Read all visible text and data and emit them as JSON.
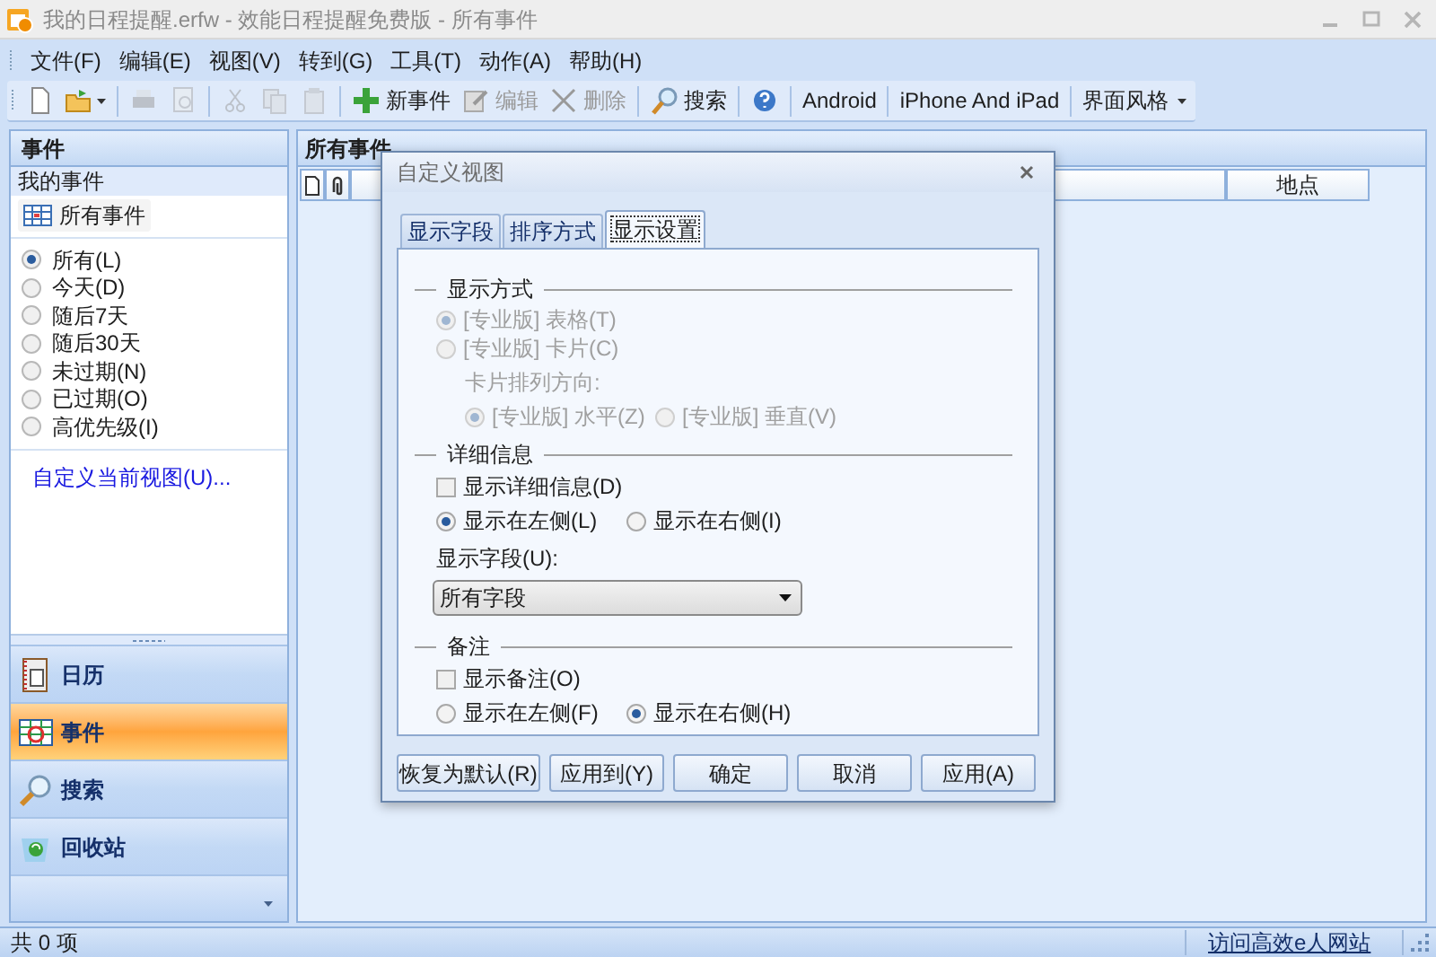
{
  "window": {
    "title": "我的日程提醒.erfw - 效能日程提醒免费版 - 所有事件"
  },
  "menu": [
    "文件(F)",
    "编辑(E)",
    "视图(V)",
    "转到(G)",
    "工具(T)",
    "动作(A)",
    "帮助(H)"
  ],
  "toolbar": [
    {
      "kind": "icon",
      "disabled": false
    },
    {
      "kind": "dropdown-icon",
      "disabled": false
    },
    {
      "kind": "separator"
    },
    {
      "kind": "icon",
      "disabled": true
    },
    {
      "kind": "icon",
      "disabled": true
    },
    {
      "kind": "separator"
    },
    {
      "kind": "icon",
      "disabled": true
    },
    {
      "kind": "icon",
      "disabled": true
    },
    {
      "kind": "icon",
      "disabled": true
    },
    {
      "kind": "separator"
    },
    {
      "kind": "text",
      "label": "新事件",
      "disabled": false
    },
    {
      "kind": "text",
      "label": "编辑",
      "disabled": true
    },
    {
      "kind": "text",
      "label": "删除",
      "disabled": true
    },
    {
      "kind": "separator"
    },
    {
      "kind": "text",
      "label": "搜索",
      "disabled": false
    },
    {
      "kind": "separator"
    },
    {
      "kind": "icon",
      "disabled": false
    },
    {
      "kind": "separator"
    },
    {
      "kind": "text",
      "label": "Android",
      "disabled": false
    },
    {
      "kind": "separator"
    },
    {
      "kind": "text",
      "label": "iPhone And iPad",
      "disabled": false
    },
    {
      "kind": "separator"
    },
    {
      "kind": "menu",
      "label": "界面风格",
      "disabled": false
    }
  ],
  "sidebar": {
    "title": "事件",
    "section": "我的事件",
    "view_button": "所有事件",
    "filters": [
      {
        "label": "所有(L)",
        "selected": true
      },
      {
        "label": "今天(D)",
        "selected": false
      },
      {
        "label": "随后7天",
        "selected": false
      },
      {
        "label": "随后30天",
        "selected": false
      },
      {
        "label": "未过期(N)",
        "selected": false
      },
      {
        "label": "已过期(O)",
        "selected": false
      },
      {
        "label": "高优先级(I)",
        "selected": false
      }
    ],
    "link": "自定义当前视图(U)...",
    "nav": [
      {
        "label": "日历",
        "selected": false
      },
      {
        "label": "事件",
        "selected": true
      },
      {
        "label": "搜索",
        "selected": false
      },
      {
        "label": "回收站",
        "selected": false
      }
    ]
  },
  "main": {
    "title": "所有事件",
    "columns": [
      {
        "kind": "icon"
      },
      {
        "kind": "icon"
      },
      {
        "kind": "blank"
      },
      {
        "kind": "text",
        "label": "地点"
      }
    ]
  },
  "dialog": {
    "title": "自定义视图",
    "tabs": [
      {
        "label": "显示字段",
        "selected": false
      },
      {
        "label": "排序方式",
        "selected": false
      },
      {
        "label": "显示设置",
        "selected": true
      }
    ],
    "sections": [
      {
        "title": "显示方式",
        "disabled": true,
        "controls": [
          {
            "kind": "radio",
            "label": "[专业版] 表格(T)",
            "checked": true
          },
          {
            "kind": "radio",
            "label": "[专业版] 卡片(C)",
            "checked": false
          },
          {
            "kind": "caption",
            "label": "卡片排列方向:"
          },
          {
            "kind": "radio-row",
            "items": [
              {
                "label": "[专业版] 水平(Z)",
                "checked": true
              },
              {
                "label": "[专业版] 垂直(V)",
                "checked": false
              }
            ]
          }
        ]
      },
      {
        "title": "详细信息",
        "disabled": false,
        "controls": [
          {
            "kind": "checkbox",
            "label": "显示详细信息(D)",
            "checked": false
          },
          {
            "kind": "radio-row",
            "items": [
              {
                "label": "显示在左侧(L)",
                "checked": true
              },
              {
                "label": "显示在右侧(I)",
                "checked": false
              }
            ]
          },
          {
            "kind": "caption",
            "label": "显示字段(U):"
          },
          {
            "kind": "select",
            "value": "所有字段"
          }
        ]
      },
      {
        "title": "备注",
        "disabled": false,
        "controls": [
          {
            "kind": "checkbox",
            "label": "显示备注(O)",
            "checked": false
          },
          {
            "kind": "radio-row",
            "items": [
              {
                "label": "显示在左侧(F)",
                "checked": false
              },
              {
                "label": "显示在右侧(H)",
                "checked": true
              }
            ]
          }
        ]
      }
    ],
    "buttons": [
      "恢复为默认(R)",
      "应用到(Y)",
      "确定",
      "取消",
      "应用(A)"
    ]
  },
  "status_bar": {
    "count": "共 0 项",
    "link": "访问高效e人网站"
  }
}
